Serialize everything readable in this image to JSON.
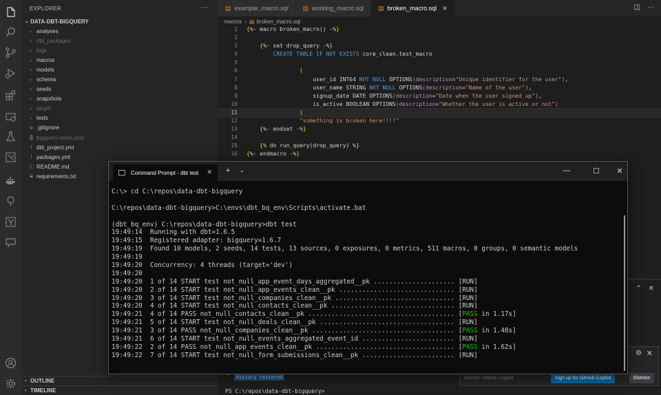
{
  "explorer": {
    "title": "EXPLORER",
    "more": "···",
    "root": "DATA-DBT-BIGQUERY",
    "items": [
      {
        "label": "analyses",
        "type": "folder",
        "dim": false
      },
      {
        "label": "dbt_packages",
        "type": "folder",
        "dim": true
      },
      {
        "label": "logs",
        "type": "folder",
        "dim": true
      },
      {
        "label": "macros",
        "type": "folder",
        "dim": false
      },
      {
        "label": "models",
        "type": "folder",
        "dim": false
      },
      {
        "label": "schema",
        "type": "folder",
        "dim": false
      },
      {
        "label": "seeds",
        "type": "folder",
        "dim": false
      },
      {
        "label": "snapshots",
        "type": "folder",
        "dim": false
      },
      {
        "label": "target",
        "type": "folder",
        "dim": true
      },
      {
        "label": "tests",
        "type": "folder",
        "dim": false
      },
      {
        "label": ".gitignore",
        "type": "git",
        "dim": false
      },
      {
        "label": "bigquery-creds.json",
        "type": "json",
        "dim": true
      },
      {
        "label": "dbt_project.yml",
        "type": "yml",
        "dim": false
      },
      {
        "label": "packages.yml",
        "type": "yml",
        "dim": false
      },
      {
        "label": "README.md",
        "type": "md",
        "dim": false
      },
      {
        "label": "requirements.txt",
        "type": "txt",
        "dim": false
      }
    ],
    "outline": "OUTLINE",
    "timeline": "TIMELINE"
  },
  "tabs": [
    {
      "label": "example_macro.sql",
      "italic": true,
      "active": false
    },
    {
      "label": "working_macro.sql",
      "italic": false,
      "active": false
    },
    {
      "label": "broken_macro.sql",
      "italic": false,
      "active": true
    }
  ],
  "breadcrumb": {
    "folder": "macros",
    "file": "broken_macro.sql"
  },
  "editor": {
    "current_line": 11
  },
  "panel": {
    "history": "History restored",
    "prompt": "PS C:\\repos\\data-dbt-bigquery>"
  },
  "notification": {
    "source": "Source: GitHub Copilot",
    "signup": "Sign up for GitHub Copilot",
    "dismiss": "Dismiss"
  },
  "cmd": {
    "tab_title": "Command Prompt - dbt  test",
    "lines": [
      "C:\\> cd C:\\repos\\data-dbt-bigquery",
      "",
      "C:\\repos\\data-dbt-bigquery>C:\\envs\\dbt_bq_env\\Scripts\\activate.bat",
      "",
      "(dbt_bq_env) C:\\repos\\data-dbt-bigquery>dbt test",
      "19:49:14  Running with dbt=1.6.5",
      "19:49:15  Registered adapter: bigquery=1.6.7",
      "19:49:19  Found 10 models, 2 seeds, 14 tests, 13 sources, 0 exposures, 0 metrics, 511 macros, 0 groups, 0 semantic models",
      "19:49:19",
      "19:49:20  Concurrency: 4 threads (target='dev')",
      "19:49:20",
      "19:49:20  1 of 14 START test not_null_app_event_days_aggregated__pk ..................... [RUN]",
      "19:49:20  2 of 14 START test not_null_app_events_clean__pk .............................. [RUN]",
      "19:49:20  3 of 14 START test not_null_companies_clean__pk ............................... [RUN]",
      "19:49:20  4 of 14 START test not_null_contacts_clean__pk ................................ [RUN]",
      "19:49:21  4 of 14 PASS not_null_contacts_clean__pk ...................................... [PASS in 1.17s]",
      "19:49:21  5 of 14 START test not_null_deals_clean__pk ................................... [RUN]",
      "19:49:21  3 of 14 PASS not_null_companies_clean__pk ..................................... [PASS in 1.48s]",
      "19:49:21  6 of 14 START test not_null_events_aggregated_event_id ........................ [RUN]",
      "19:49:22  2 of 14 PASS not_null_app_events_clean__pk .................................... [PASS in 1.62s]",
      "19:49:22  7 of 14 START test not_null_form_submissions_clean__pk ........................ [RUN]"
    ]
  }
}
